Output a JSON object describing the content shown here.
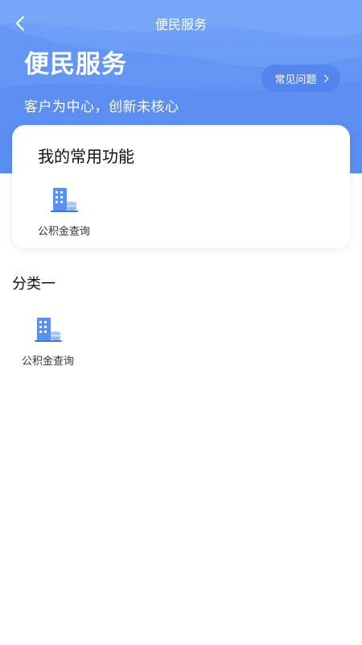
{
  "nav": {
    "title": "便民服务"
  },
  "hero": {
    "title": "便民服务",
    "subtitle": "客户为中心，创新未核心"
  },
  "faq_button": {
    "label": "常见问题"
  },
  "frequent": {
    "title": "我的常用功能",
    "items": [
      {
        "label": "公积金查询",
        "icon": "building-coins-icon"
      }
    ]
  },
  "category": {
    "title": "分类一",
    "items": [
      {
        "label": "公积金查询",
        "icon": "building-coins-icon"
      }
    ]
  },
  "colors": {
    "header_blue": "#6a9cf6",
    "icon_blue": "#5b8ff1",
    "icon_light": "#a9c6fb"
  }
}
